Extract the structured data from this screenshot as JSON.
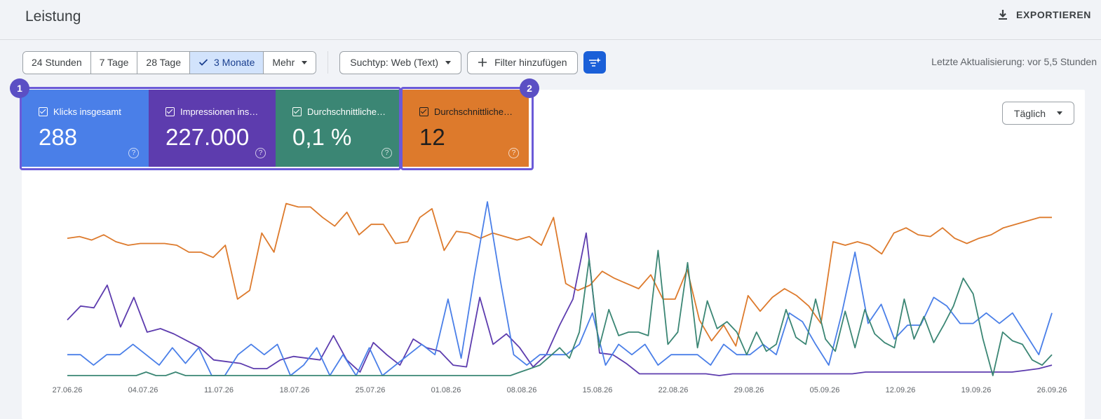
{
  "header": {
    "title": "Leistung",
    "export_label": "EXPORTIEREN"
  },
  "toolbar": {
    "ranges": [
      "24 Stunden",
      "7 Tage",
      "28 Tage",
      "3 Monate",
      "Mehr"
    ],
    "active_range": "3 Monate",
    "search_type": "Suchtyp: Web (Text)",
    "add_filter": "Filter hinzufügen",
    "last_update": "Letzte Aktualisierung: vor 5,5 Stunden"
  },
  "badges": {
    "b1": "1",
    "b2": "2"
  },
  "metrics": [
    {
      "label": "Klicks insgesamt",
      "value": "288",
      "color": "#4a7fe8"
    },
    {
      "label": "Impressionen ins…",
      "value": "227.000",
      "color": "#5d3cae"
    },
    {
      "label": "Durchschnittliche…",
      "value": "0,1 %",
      "color": "#3b8674"
    },
    {
      "label": "Durchschnittliche…",
      "value": "12",
      "color": "#dd7a2c"
    }
  ],
  "granularity": "Täglich",
  "chart_data": {
    "type": "line",
    "x": [
      "27.06.26",
      "04.07.26",
      "11.07.26",
      "18.07.26",
      "25.07.26",
      "01.08.26",
      "08.08.26",
      "15.08.26",
      "22.08.26",
      "29.08.26",
      "05.09.26",
      "12.09.26",
      "19.09.26",
      "26.09.26"
    ],
    "tick_labels": [
      "27.06.26",
      "04.07.26",
      "11.07.26",
      "18.07.26",
      "25.07.26",
      "01.08.26",
      "08.08.26",
      "15.08.26",
      "22.08.26",
      "29.08.26",
      "05.09.26",
      "12.09.26",
      "19.09.26",
      "26.09.26"
    ],
    "grid": false,
    "series": [
      {
        "metric": "Position",
        "color": "#dd7a2c",
        "values": [
          0.79,
          0.8,
          0.78,
          0.81,
          0.77,
          0.75,
          0.76,
          0.76,
          0.76,
          0.75,
          0.71,
          0.71,
          0.68,
          0.75,
          0.44,
          0.49,
          0.82,
          0.71,
          0.99,
          0.97,
          0.97,
          0.91,
          0.86,
          0.94,
          0.81,
          0.87,
          0.87,
          0.76,
          0.77,
          0.91,
          0.96,
          0.72,
          0.83,
          0.82,
          0.79,
          0.82,
          0.8,
          0.78,
          0.8,
          0.75,
          0.91,
          0.53,
          0.49,
          0.52,
          0.6,
          0.56,
          0.53,
          0.5,
          0.58,
          0.44,
          0.44,
          0.61,
          0.32,
          0.2,
          0.29,
          0.17,
          0.46,
          0.37,
          0.45,
          0.5,
          0.46,
          0.4,
          0.3,
          0.77,
          0.75,
          0.77,
          0.75,
          0.7,
          0.82,
          0.85,
          0.81,
          0.8,
          0.85,
          0.79,
          0.76,
          0.79,
          0.81,
          0.85,
          0.87,
          0.89,
          0.91,
          0.91
        ]
      },
      {
        "metric": "Impressionen",
        "color": "#5d3cae",
        "values": [
          0.32,
          0.4,
          0.39,
          0.52,
          0.28,
          0.45,
          0.25,
          0.27,
          0.24,
          0.2,
          0.16,
          0.09,
          0.08,
          0.07,
          0.04,
          0.04,
          0.09,
          0.11,
          0.1,
          0.09,
          0.23,
          0.09,
          0.02,
          0.19,
          0.12,
          0.06,
          0.21,
          0.16,
          0.14,
          0.06,
          0.05,
          0.45,
          0.18,
          0.24,
          0.16,
          0.05,
          0.12,
          0.29,
          0.44,
          0.82,
          0.13,
          0.12,
          0.07,
          0.01,
          0.01,
          0.01,
          0.01,
          0.01,
          0.01,
          0.0,
          0.01,
          0.01,
          0.01,
          0.01,
          0.01,
          0.01,
          0.01,
          0.01,
          0.01,
          0.01,
          0.02,
          0.02,
          0.02,
          0.02,
          0.02,
          0.02,
          0.02,
          0.02,
          0.02,
          0.02,
          0.02,
          0.02,
          0.03,
          0.04,
          0.06
        ]
      },
      {
        "metric": "Klicks",
        "color": "#4a7fe8",
        "values": [
          0.12,
          0.12,
          0.06,
          0.12,
          0.12,
          0.18,
          0.12,
          0.06,
          0.16,
          0.07,
          0.16,
          0.0,
          0.0,
          0.12,
          0.18,
          0.12,
          0.18,
          0.0,
          0.06,
          0.16,
          0.0,
          0.12,
          0.0,
          0.16,
          0.0,
          0.06,
          0.12,
          0.18,
          0.12,
          0.44,
          0.1,
          0.57,
          1.0,
          0.54,
          0.12,
          0.06,
          0.12,
          0.12,
          0.12,
          0.18,
          0.36,
          0.06,
          0.18,
          0.12,
          0.18,
          0.06,
          0.12,
          0.12,
          0.12,
          0.06,
          0.18,
          0.12,
          0.12,
          0.18,
          0.12,
          0.36,
          0.31,
          0.18,
          0.06,
          0.36,
          0.71,
          0.3,
          0.41,
          0.21,
          0.29,
          0.29,
          0.45,
          0.4,
          0.3,
          0.3,
          0.36,
          0.3,
          0.36,
          0.24,
          0.12,
          0.36
        ]
      },
      {
        "metric": "CTR",
        "color": "#3b8674",
        "values": [
          0.0,
          0.0,
          0.0,
          0.0,
          0.0,
          0.0,
          0.0,
          0.0,
          0.02,
          0.0,
          0.0,
          0.02,
          0.0,
          0.0,
          0.0,
          0.0,
          0.0,
          0.0,
          0.0,
          0.0,
          0.0,
          0.0,
          0.0,
          0.0,
          0.0,
          0.0,
          0.0,
          0.0,
          0.0,
          0.0,
          0.0,
          0.0,
          0.0,
          0.0,
          0.0,
          0.0,
          0.0,
          0.0,
          0.0,
          0.0,
          0.0,
          0.0,
          0.0,
          0.0,
          0.0,
          0.0,
          0.02,
          0.04,
          0.06,
          0.11,
          0.16,
          0.1,
          0.25,
          0.67,
          0.16,
          0.38,
          0.23,
          0.25,
          0.25,
          0.23,
          0.72,
          0.18,
          0.25,
          0.65,
          0.16,
          0.43,
          0.27,
          0.31,
          0.25,
          0.12,
          0.25,
          0.14,
          0.18,
          0.38,
          0.22,
          0.18,
          0.44,
          0.21,
          0.14,
          0.37,
          0.16,
          0.38,
          0.24,
          0.19,
          0.16,
          0.44,
          0.21,
          0.34,
          0.19,
          0.29,
          0.4,
          0.56,
          0.47,
          0.21,
          0.0,
          0.25,
          0.2,
          0.18,
          0.09,
          0.06,
          0.12
        ]
      }
    ]
  }
}
